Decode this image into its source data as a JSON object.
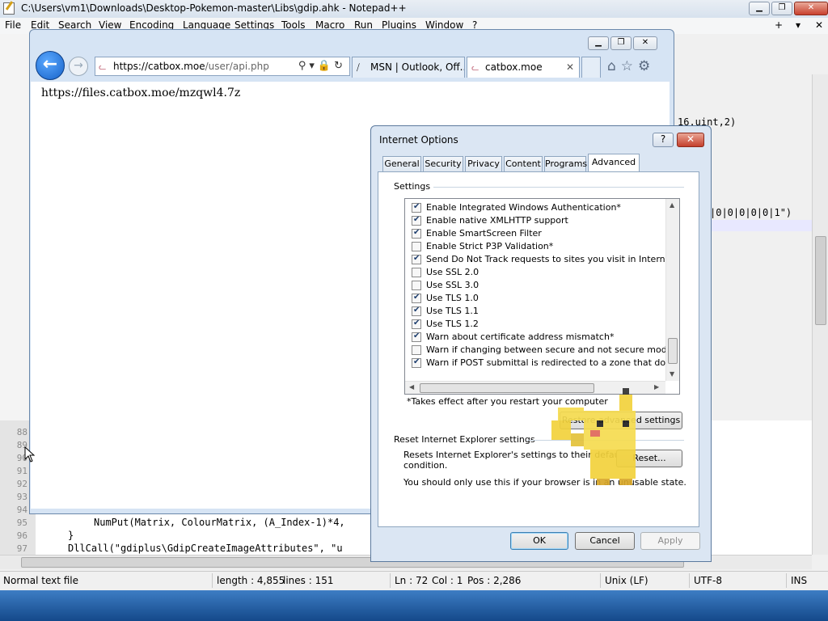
{
  "notepad": {
    "title": "C:\\Users\\vm1\\Downloads\\Desktop-Pokemon-master\\Libs\\gdip.ahk - Notepad++",
    "menu": [
      "File",
      "Edit",
      "Search",
      "View",
      "Encoding",
      "Language",
      "Settings",
      "Tools",
      "Macro",
      "Run",
      "Plugins",
      "Window",
      "?"
    ],
    "menu_right": [
      "+",
      "▾",
      "✕"
    ],
    "line_numbers": [
      "88",
      "89",
      "90",
      "91",
      "92",
      "93",
      "94",
      "95",
      "96",
      "97"
    ],
    "code_lines": [
      "NumPut(Matrix, ColourMatrix, (A_Index-1)*4,",
      "}",
      "DllCall(\"gdiplus\\GdipCreateImageAttributes\", \"u"
    ],
    "right_code": [
      "16.uint,2)",
      "|0|0|0|0|0|1\")"
    ],
    "status": {
      "file_type": "Normal text file",
      "length": "length : 4,855",
      "lines": "lines : 151",
      "ln": "Ln : 72",
      "col": "Col : 1",
      "pos": "Pos : 2,286",
      "eol": "Unix (LF)",
      "encoding": "UTF-8",
      "mode": "INS"
    }
  },
  "ie": {
    "address": "https://catbox.moe/user/api.php",
    "address_host": "https://catbox.moe",
    "address_path": "/user/api.php",
    "tabs": [
      {
        "label": "MSN | Outlook, Off..."
      },
      {
        "label": "catbox.moe"
      }
    ],
    "body_text": "https://files.catbox.moe/mzqwl4.7z"
  },
  "dialog": {
    "title": "Internet Options",
    "help": "?",
    "close": "✕",
    "tabs": [
      "General",
      "Security",
      "Privacy",
      "Content",
      "Programs",
      "Advanced"
    ],
    "active_tab": "Advanced",
    "settings_label": "Settings",
    "settings": [
      {
        "label": "Enable Integrated Windows Authentication*",
        "checked": true
      },
      {
        "label": "Enable native XMLHTTP support",
        "checked": true
      },
      {
        "label": "Enable SmartScreen Filter",
        "checked": true
      },
      {
        "label": "Enable Strict P3P Validation*",
        "checked": false
      },
      {
        "label": "Send Do Not Track requests to sites you visit in Internet E",
        "checked": true
      },
      {
        "label": "Use SSL 2.0",
        "checked": false
      },
      {
        "label": "Use SSL 3.0",
        "checked": false
      },
      {
        "label": "Use TLS 1.0",
        "checked": true
      },
      {
        "label": "Use TLS 1.1",
        "checked": true
      },
      {
        "label": "Use TLS 1.2",
        "checked": true
      },
      {
        "label": "Warn about certificate address mismatch*",
        "checked": true
      },
      {
        "label": "Warn if changing between secure and not secure mode",
        "checked": false
      },
      {
        "label": "Warn if POST submittal is redirected to a zone that does n",
        "checked": true
      }
    ],
    "restart_note": "*Takes effect after you restart your computer",
    "restore_button": "Restore advanced settings",
    "reset_group": "Reset Internet Explorer settings",
    "reset_desc": "Resets Internet Explorer's settings to their default condition.",
    "reset_desc_line1": "Resets Internet Explorer's settings to their default",
    "reset_desc_line2": "condition.",
    "reset_button": "Reset...",
    "unusable_note": "You should only use this if your browser is in an unusable state.",
    "ok": "OK",
    "cancel": "Cancel",
    "apply": "Apply"
  }
}
